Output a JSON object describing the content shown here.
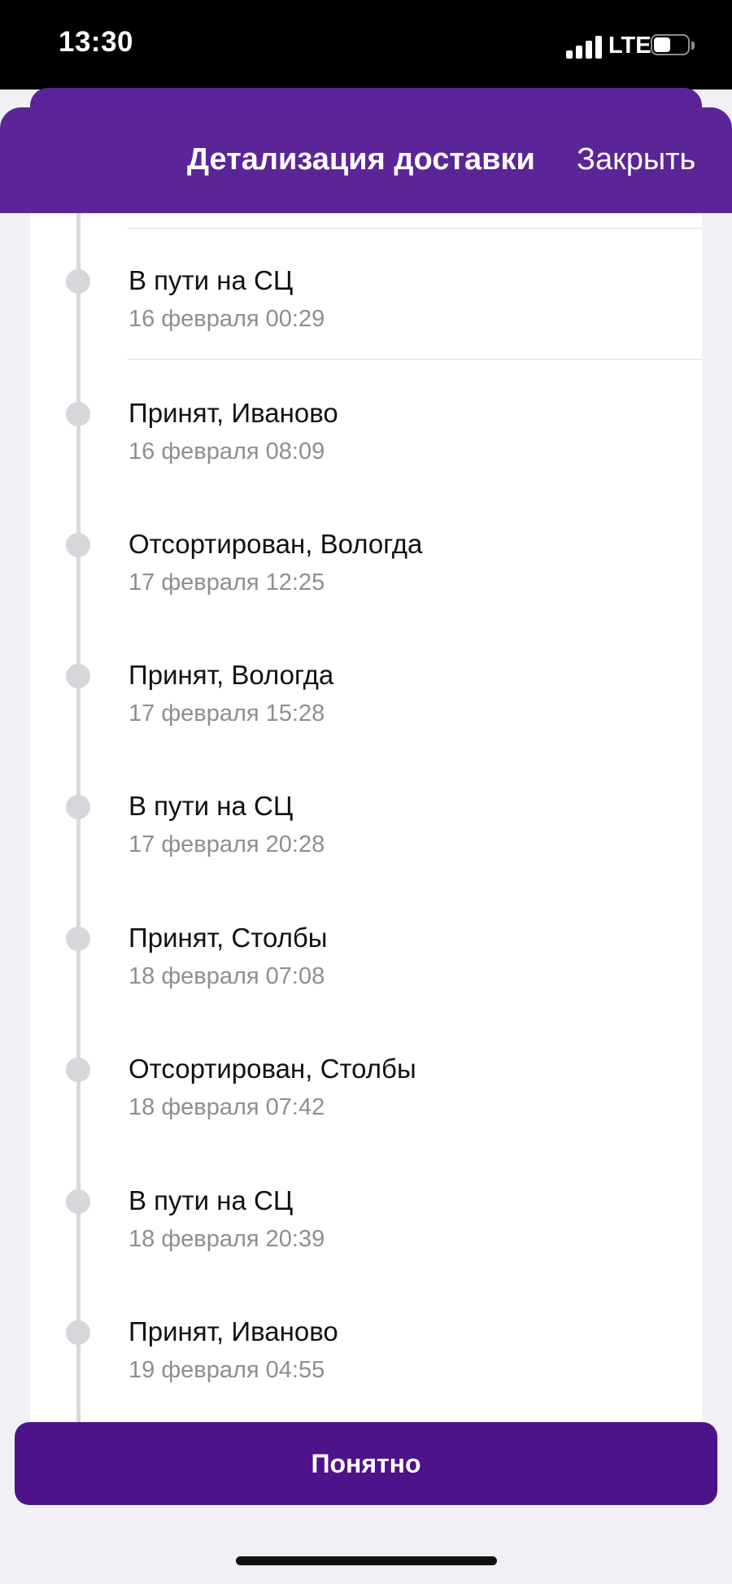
{
  "status_bar": {
    "time": "13:30",
    "network": "LTE",
    "signal_icon": "cellular-signal-icon",
    "battery_icon": "battery-icon",
    "battery_level": 0.5
  },
  "header": {
    "title": "Детализация доставки",
    "close_label": "Закрыть"
  },
  "timeline": {
    "events": [
      {
        "status": "В пути на СЦ",
        "datetime": "16 февраля 00:29"
      },
      {
        "status": "Принят, Иваново",
        "datetime": "16 февраля 08:09"
      },
      {
        "status": "Отсортирован, Вологда",
        "datetime": "17 февраля 12:25"
      },
      {
        "status": "Принят, Вологда",
        "datetime": "17 февраля 15:28"
      },
      {
        "status": "В пути на СЦ",
        "datetime": "17 февраля 20:28"
      },
      {
        "status": "Принят, Столбы",
        "datetime": "18 февраля 07:08"
      },
      {
        "status": "Отсортирован, Столбы",
        "datetime": "18 февраля 07:42"
      },
      {
        "status": "В пути на СЦ",
        "datetime": "18 февраля 20:39"
      },
      {
        "status": "Принят, Иваново",
        "datetime": "19 февраля 04:55"
      }
    ]
  },
  "footer": {
    "ok_label": "Понятно"
  },
  "colors": {
    "header_background": "#5c2597",
    "button_background": "#4e128a",
    "secondary_text": "#8e8e93",
    "timeline": "#d9d9dd"
  }
}
